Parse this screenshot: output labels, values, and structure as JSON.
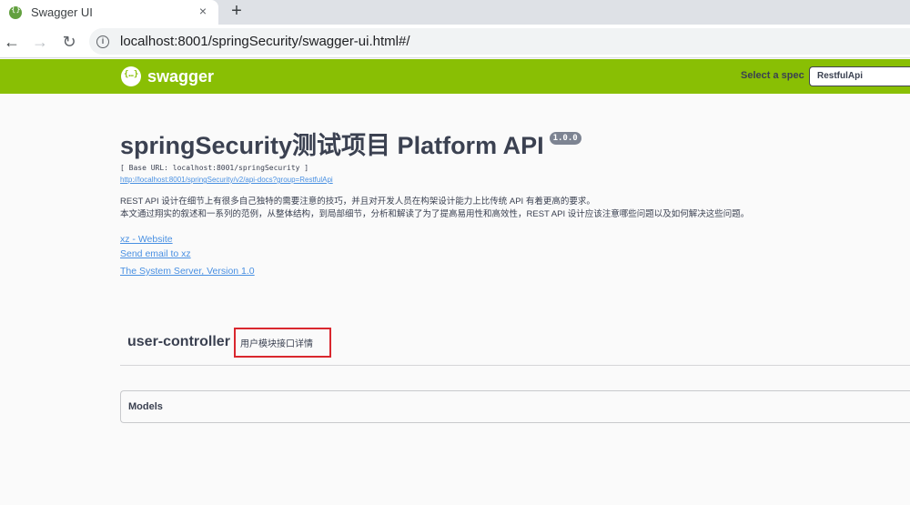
{
  "browser": {
    "tab_title": "Swagger UI",
    "close_glyph": "×",
    "new_tab_glyph": "+",
    "back_glyph": "←",
    "forward_glyph": "→",
    "reload_glyph": "↻",
    "info_glyph": "i",
    "url": "localhost:8001/springSecurity/swagger-ui.html#/"
  },
  "topbar": {
    "logo_text": "swagger",
    "spec_label": "Select a spec",
    "spec_value": "RestfulApi"
  },
  "info": {
    "title": "springSecurity测试项目 Platform API",
    "version": "1.0.0",
    "base_url": "[ Base URL: localhost:8001/springSecurity ]",
    "docs_url": "http://localhost:8001/springSecurity/v2/api-docs?group=RestfulApi",
    "description_line1": "REST API 设计在细节上有很多自己独特的需要注意的技巧，并且对开发人员在构架设计能力上比传统 API 有着更高的要求。",
    "description_line2": "本文通过翔实的叙述和一系列的范例，从整体结构，到局部细节，分析和解读了为了提高易用性和高效性，REST API 设计应该注意哪些问题以及如何解决这些问题。",
    "website_link": "xz - Website",
    "email_link": "Send email to xz",
    "server_link": "The System Server, Version 1.0"
  },
  "controller": {
    "name": "user-controller",
    "description": "用户模块接口详情"
  },
  "models": {
    "title": "Models"
  },
  "colors": {
    "topbar": "#89bf04",
    "highlight_border": "#d9272e",
    "link": "#4990e2",
    "text": "#3b4151"
  }
}
